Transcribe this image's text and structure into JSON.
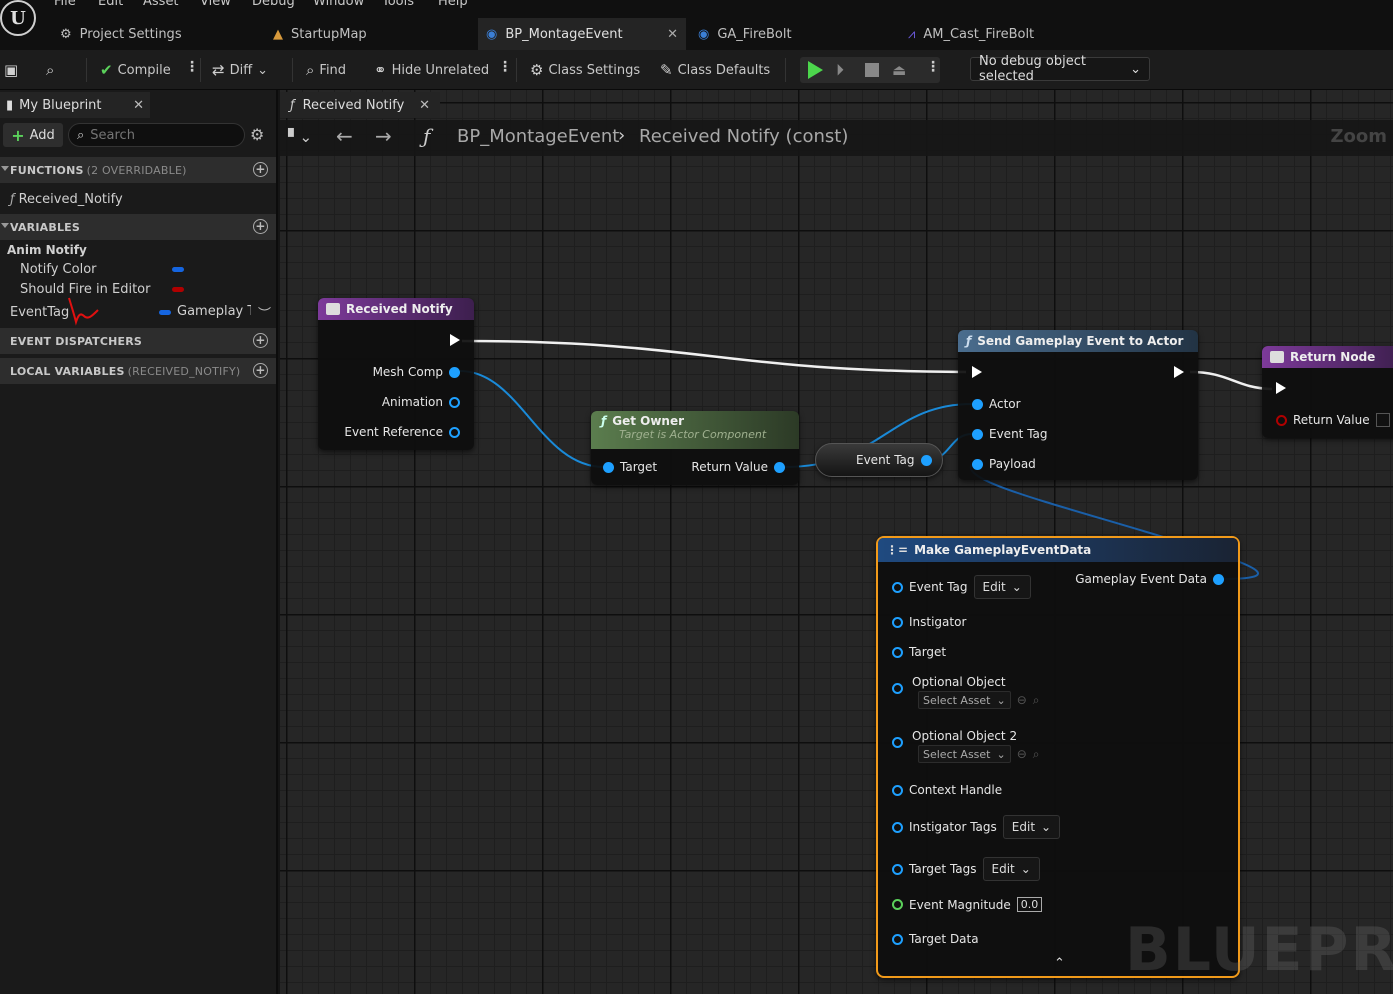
{
  "menu": [
    "File",
    "Edit",
    "Asset",
    "View",
    "Debug",
    "Window",
    "Tools",
    "Help"
  ],
  "tabs": [
    {
      "label": "Project Settings",
      "icon": "settings-icon"
    },
    {
      "label": "StartupMap",
      "icon": "map-icon"
    },
    {
      "label": "BP_MontageEvent",
      "icon": "blueprint-icon",
      "active": true
    },
    {
      "label": "GA_FireBolt",
      "icon": "blueprint-icon"
    },
    {
      "label": "AM_Cast_FireBolt",
      "icon": "montage-icon"
    }
  ],
  "toolbar": {
    "compile": "Compile",
    "diff": "Diff",
    "find": "Find",
    "hide_unrelated": "Hide Unrelated",
    "class_settings": "Class Settings",
    "class_defaults": "Class Defaults",
    "debug_select": "No debug object selected"
  },
  "my_blueprint": {
    "tab": "My Blueprint",
    "add": "Add",
    "search_placeholder": "Search",
    "functions_header": "FUNCTIONS",
    "functions_sub": "(2 OVERRIDABLE)",
    "functions": [
      "Received_Notify"
    ],
    "variables_header": "VARIABLES",
    "anim_notify_category": "Anim Notify",
    "variables": [
      {
        "name": "Notify Color",
        "color": "#1565e0"
      },
      {
        "name": "Should Fire in Editor",
        "color": "#b00000"
      }
    ],
    "eventtag_var": {
      "name": "EventTag",
      "type": "Gameplay Ta",
      "color": "#1565e0"
    },
    "event_dispatchers_header": "EVENT DISPATCHERS",
    "local_variables_header": "LOCAL VARIABLES",
    "local_variables_sub": "(RECEIVED_NOTIFY)"
  },
  "graph": {
    "tab": "Received Notify",
    "breadcrumb_root": "BP_MontageEvent",
    "breadcrumb_leaf": "Received Notify (const)",
    "zoom": "Zoom",
    "watermark": "BLUEPRINT"
  },
  "nodes": {
    "received_notify": {
      "title": "Received Notify",
      "pins": [
        "Mesh Comp",
        "Animation",
        "Event Reference"
      ]
    },
    "get_owner": {
      "title": "Get Owner",
      "subtitle": "Target is Actor Component",
      "in": "Target",
      "out": "Return Value"
    },
    "event_tag_var": {
      "label": "Event Tag"
    },
    "send_event": {
      "title": "Send Gameplay Event to Actor",
      "pins": [
        "Actor",
        "Event Tag",
        "Payload"
      ]
    },
    "return_node": {
      "title": "Return Node",
      "pin": "Return Value"
    },
    "make_data": {
      "title": "Make GameplayEventData",
      "output": "Gameplay Event Data",
      "edit": "Edit",
      "select_asset": "Select Asset",
      "magnitude": "0.0",
      "pins": [
        "Event Tag",
        "Instigator",
        "Target",
        "Optional Object",
        "Optional Object 2",
        "Context Handle",
        "Instigator Tags",
        "Target Tags",
        "Event Magnitude",
        "Target Data"
      ]
    }
  }
}
